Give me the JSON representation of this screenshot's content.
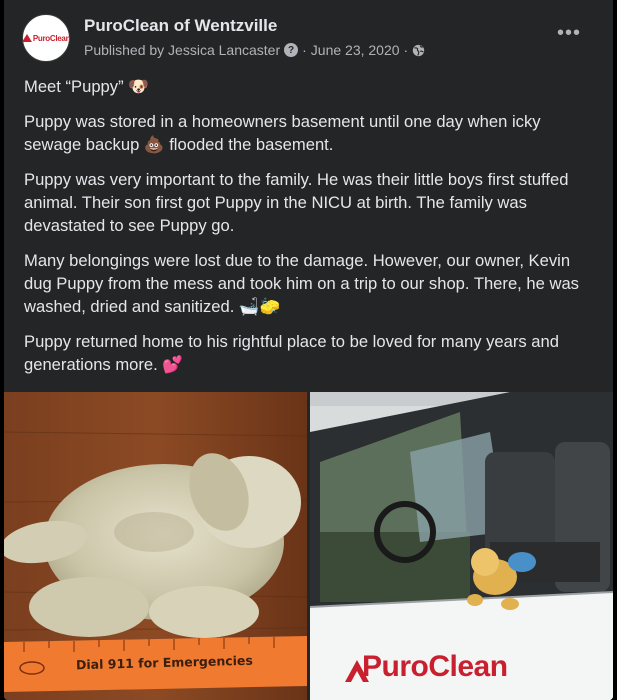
{
  "post": {
    "page_name": "PuroClean of Wentzville",
    "avatar_text": "PuroClean",
    "published_by": "Published by Jessica Lancaster",
    "separator": "·",
    "date": "June 23, 2020",
    "more_label": "•••",
    "paragraphs": [
      "Meet “Puppy” 🐶",
      "Puppy was stored in a homeowners basement until one day when icky sewage backup 💩 flooded the basement.",
      "Puppy was very important to the family. He was their little boys first stuffed animal. Their son first got Puppy in the NICU at birth. The family was devastated to see Puppy go.",
      "Many belongings were lost due to the damage. However, our owner, Kevin dug Puppy from the mess and took him on a trip to our shop. There, he was washed, dried and sanitized. 🛁🧽",
      "Puppy returned home to his rightful place to be loved for many years and generations more. 💕"
    ]
  },
  "photos": {
    "left": {
      "ruler_text": "Dial 911 for Emergencies"
    },
    "right": {
      "logo_text": "PuroClean",
      "trademark": "®"
    }
  },
  "colors": {
    "background": "#242526",
    "text": "#e4e6eb",
    "secondary_text": "#b0b3b8",
    "brand_red": "#c8202f"
  },
  "icons": [
    "help-icon",
    "globe-icon",
    "more-options-icon"
  ]
}
